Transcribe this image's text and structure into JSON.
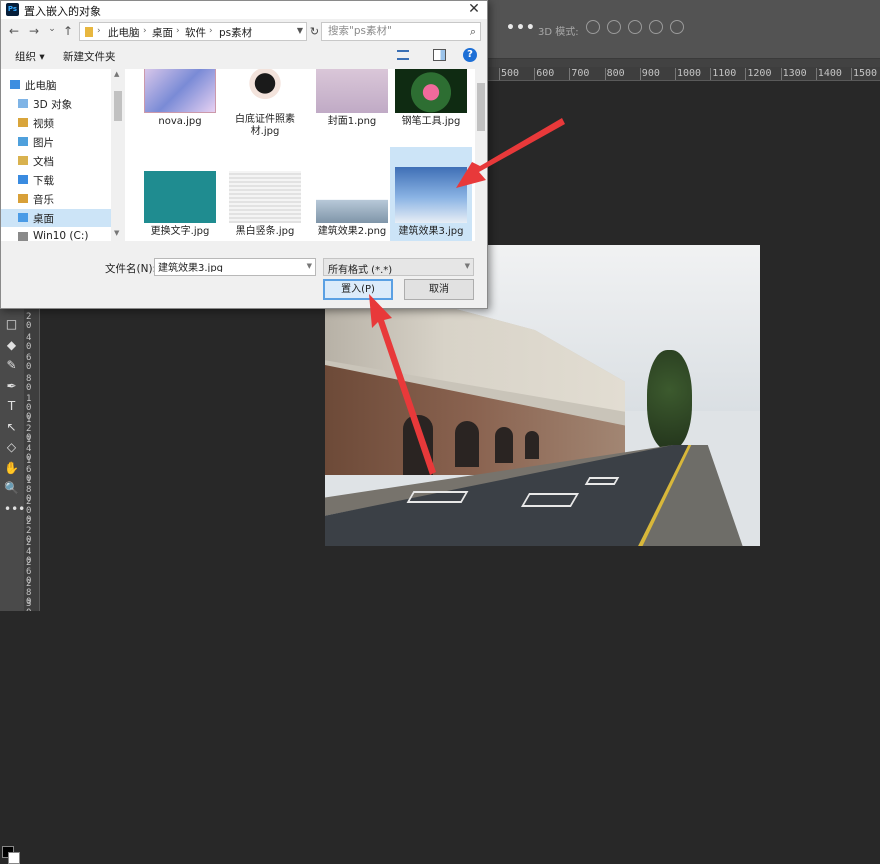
{
  "dialog": {
    "title": "置入嵌入的对象",
    "logo": "Ps",
    "close_glyph": "✕",
    "nav": {
      "back": "←",
      "forward": "→",
      "recent": "⌄",
      "up": "↑"
    },
    "breadcrumbs": [
      "此电脑",
      "桌面",
      "软件",
      "ps素材"
    ],
    "breadcrumb_sep": "›",
    "search_placeholder": "搜索\"ps素材\"",
    "toolbar": {
      "organize": "组织 ▾",
      "new_folder": "新建文件夹",
      "help": "?"
    },
    "nav_pane": [
      {
        "label": "此电脑",
        "icon": "computer-icon"
      },
      {
        "label": "3D 对象",
        "icon": "3d-objects-icon"
      },
      {
        "label": "视频",
        "icon": "video-icon"
      },
      {
        "label": "图片",
        "icon": "pictures-icon"
      },
      {
        "label": "文档",
        "icon": "documents-icon"
      },
      {
        "label": "下载",
        "icon": "downloads-icon"
      },
      {
        "label": "音乐",
        "icon": "music-icon"
      },
      {
        "label": "桌面",
        "icon": "desktop-icon",
        "selected": true
      },
      {
        "label": "Win10 (C:)",
        "icon": "drive-icon"
      }
    ],
    "files": [
      {
        "name": "nova.jpg"
      },
      {
        "name": "白底证件照素材.jpg"
      },
      {
        "name": "封面1.png"
      },
      {
        "name": "钢笔工具.jpg"
      },
      {
        "name": "更换文字.jpg"
      },
      {
        "name": "黑白竖条.jpg"
      },
      {
        "name": "建筑效果2.png"
      },
      {
        "name": "建筑效果3.jpg",
        "selected": true
      }
    ],
    "filename_label": "文件名(N):",
    "filename_value": "建筑效果3.jpg",
    "filetype_value": "所有格式 (*.*)",
    "place_button": "置入(P)",
    "cancel_button": "取消"
  },
  "photoshop": {
    "options_more": "•••",
    "mode_label": "3D 模式:",
    "ruler_top": [
      "500",
      "600",
      "700",
      "800",
      "900",
      "1000",
      "1100",
      "1200",
      "1300",
      "1400",
      "1500"
    ],
    "ruler_left": [
      "20",
      "40",
      "60",
      "80",
      "100",
      "120",
      "140",
      "160",
      "180",
      "200",
      "220",
      "240",
      "260",
      "280",
      "300",
      "320"
    ],
    "tools": [
      "□",
      "◆",
      "✎",
      "✒",
      "T",
      "↖",
      "◇",
      "✋",
      "🔍",
      "•••"
    ]
  }
}
